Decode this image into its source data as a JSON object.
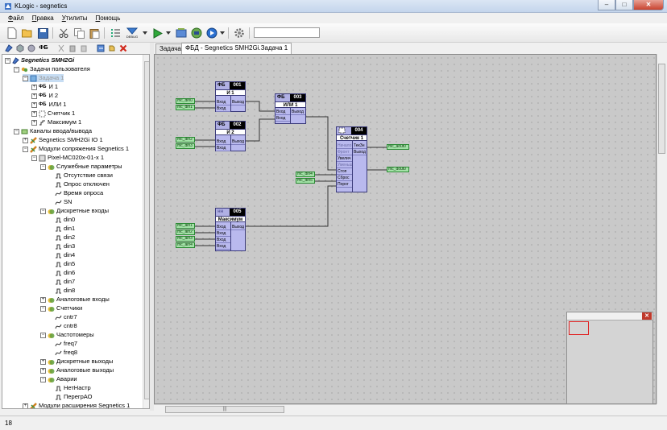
{
  "window": {
    "title": "KLogic - segnetics",
    "min": "‒",
    "max": "□",
    "close": "✕"
  },
  "menu": [
    {
      "hot": "Ф",
      "rest": "айл"
    },
    {
      "hot": "П",
      "rest": "равка"
    },
    {
      "hot": "У",
      "rest": "тилиты"
    },
    {
      "hot": "П",
      "rest": "омощь"
    }
  ],
  "toolbar": {
    "debug_label": "DEBUG",
    "search_value": ""
  },
  "left_toolbar": {
    "fb_label": "ФБ"
  },
  "tree": {
    "root": "Segnetics SMH2Gi",
    "user_tasks": "Задачи пользователя",
    "task1": "Задача 1",
    "fb_and1": "И 1",
    "fb_and2": "И 2",
    "fb_or1": "ИЛИ 1",
    "counter1": "Счетчик 1",
    "max1": "Максимум 1",
    "io_channels": "Каналы ввода/вывода",
    "io1": "Segnetics SMH2Gi IO 1",
    "modules": "Модули сопряжения Segnetics 1",
    "pixel": "Pixel-MC020x-01-x 1",
    "service": "Служебные параметры",
    "no_link": "Отсутствие связи",
    "poll_off": "Опрос отключен",
    "poll_time": "Время опроса",
    "sn": "SN",
    "discrete_in": "Дискретные входы",
    "din": [
      "din0",
      "din1",
      "din2",
      "din3",
      "din4",
      "din5",
      "din6",
      "din7",
      "din8"
    ],
    "analog_in": "Аналоговые входы",
    "counters": "Счетчики",
    "cntr": [
      "cntr7",
      "cntr8"
    ],
    "freqmeters": "Частотомеры",
    "freq": [
      "freq7",
      "freq8"
    ],
    "discrete_out": "Дискретные выходы",
    "analog_out": "Аналоговые выходы",
    "alarms": "Аварии",
    "alarm_items": [
      "НетНастр",
      "ПерегрАО"
    ],
    "expansion": "Модули расширения Segnetics 1"
  },
  "tabs": [
    "Задача",
    "ФБД - Segnetics SMH2Gi.Задача 1"
  ],
  "signals": {
    "din0": "mc_din0",
    "din1": "mc_din1",
    "din2": "mc_din2",
    "din3": "mc_din3",
    "din4": "mc_din4",
    "din5": "mc_din5",
    "ain1": "mc_ain1",
    "ain2": "mc_ain2",
    "ain3": "mc_ain3",
    "ain4": "mc_ain4",
    "aout0": "mc_aout0",
    "dout0": "mc_dout0"
  },
  "blocks": {
    "and1": {
      "type": "ФБ",
      "num": "001",
      "name": "И 1",
      "in1": "Вход",
      "in2": "Вход",
      "out": "Выход"
    },
    "and2": {
      "type": "ФБ",
      "num": "002",
      "name": "И 2",
      "in1": "Вход",
      "in2": "Вход",
      "out": "Выход"
    },
    "or1": {
      "type": "ФБ",
      "num": "003",
      "name": "ИЛИ 1",
      "in1": "Вход",
      "in2": "Вход",
      "out": "Выход"
    },
    "cnt1": {
      "num": "004",
      "name": "Счетчик 1",
      "pins_left": [
        "Начало",
        "Фронт",
        "Увелич",
        "Уменьш",
        "Стоп",
        "Сброс",
        "Порог"
      ],
      "pins_right": [
        "ТекЗн",
        "Выход"
      ]
    },
    "max1": {
      "type": "нн",
      "num": "005",
      "name": "Максимум",
      "in1": "Вход",
      "in2": "Вход",
      "in3": "Вход",
      "in4": "Вход",
      "out": "Выход"
    }
  },
  "statusbar": {
    "text": "18"
  },
  "colors": {
    "signal_fill": "#a4e2a8",
    "block_fill": "#b9b9ee",
    "canvas": "#c9c9c9"
  }
}
